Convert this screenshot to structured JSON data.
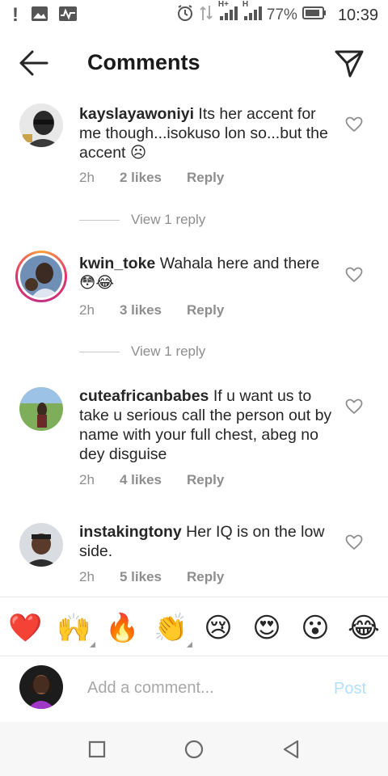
{
  "status_bar": {
    "battery_percent": "77%",
    "time": "10:39",
    "network_label_1": "H+",
    "network_label_2": "H"
  },
  "header": {
    "title": "Comments"
  },
  "comments": [
    {
      "username": "kayslayawoniyi",
      "text": " Its her accent for me though...isokuso lon so...but the accent ☹",
      "time": "2h",
      "likes": "2 likes",
      "reply": "Reply",
      "view_replies": "View 1 reply"
    },
    {
      "username": "kwin_toke",
      "text": " Wahala here and there 😳😂",
      "time": "2h",
      "likes": "3 likes",
      "reply": "Reply",
      "view_replies": "View 1 reply"
    },
    {
      "username": "cuteafricanbabes",
      "text": " If u want us to take u serious call the person out by name with your full chest, abeg no dey disguise",
      "time": "2h",
      "likes": "4 likes",
      "reply": "Reply"
    },
    {
      "username": "instakingtony",
      "text": " Her IQ is on the low side.",
      "time": "2h",
      "likes": "5 likes",
      "reply": "Reply"
    }
  ],
  "emoji_bar": [
    "❤️",
    "🙌",
    "🔥",
    "👏",
    "😢",
    "😍",
    "😮",
    "😂"
  ],
  "composer": {
    "placeholder": "Add a comment...",
    "post_label": "Post"
  },
  "colors": {
    "accent_post_disabled": "#b2dffc",
    "meta_gray": "#8e8e8e",
    "story_ring": "#e1306c"
  },
  "icons": {
    "back": "arrow-left-icon",
    "send": "paper-plane-icon",
    "like": "heart-outline-icon"
  }
}
